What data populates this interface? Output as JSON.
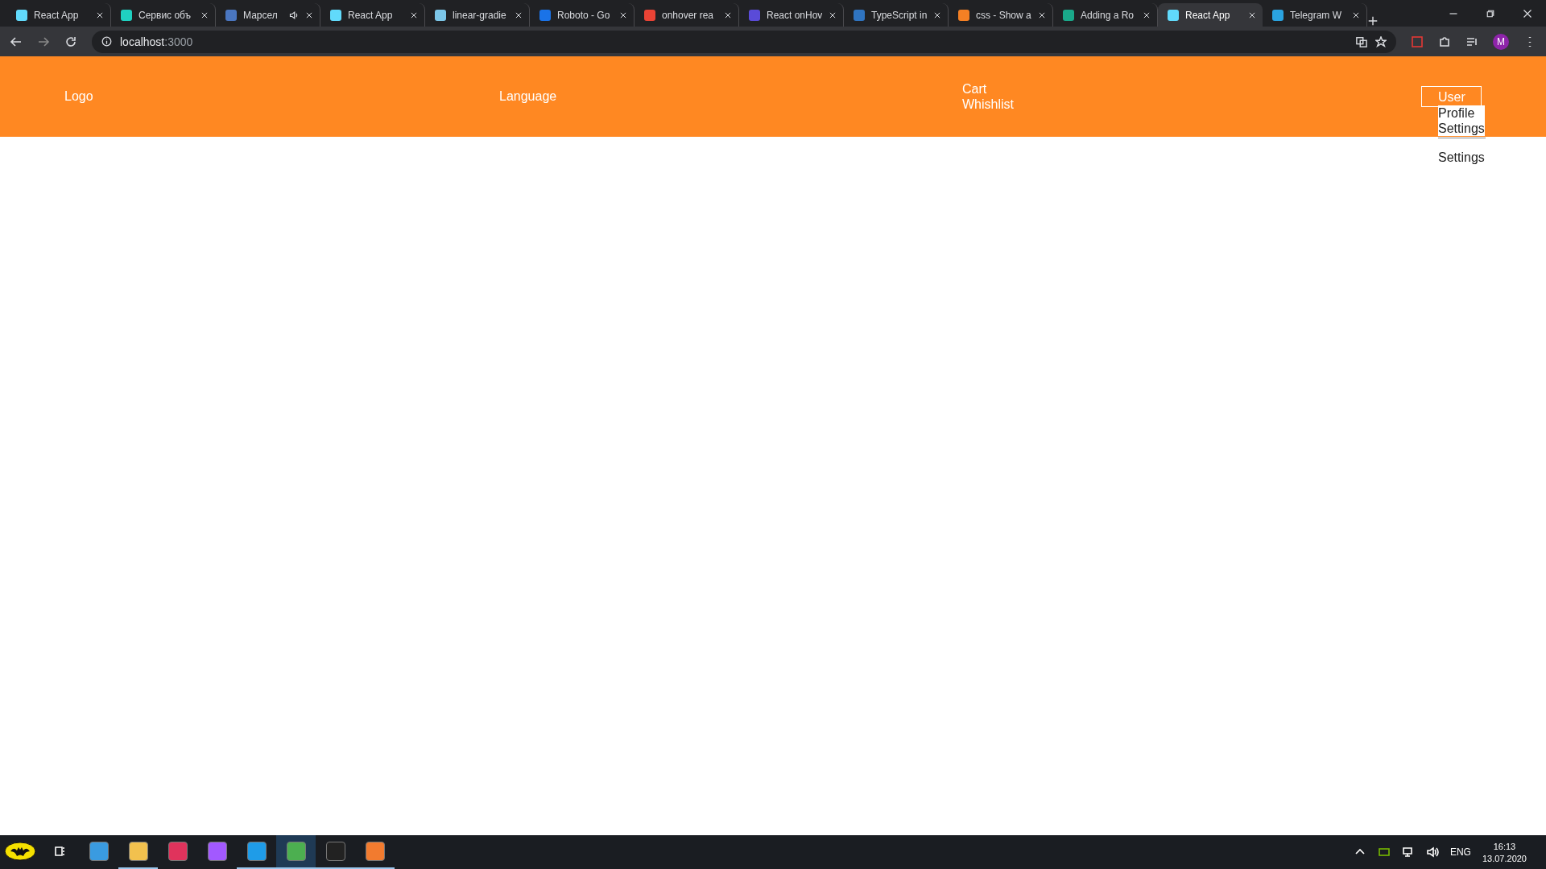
{
  "browser": {
    "tabs": [
      {
        "title": "React App",
        "color": "#61dafb",
        "audio": false,
        "selected": false
      },
      {
        "title": "Сервис объ",
        "color": "#1fd1c1",
        "audio": false,
        "selected": false
      },
      {
        "title": "Марсел",
        "color": "#4a76c0",
        "audio": true,
        "selected": false
      },
      {
        "title": "React App",
        "color": "#61dafb",
        "audio": false,
        "selected": false
      },
      {
        "title": "linear-gradie",
        "color": "#7cc6e8",
        "audio": false,
        "selected": false
      },
      {
        "title": "Roboto - Go",
        "color": "#1a73e8",
        "audio": false,
        "selected": false
      },
      {
        "title": "onhover rea",
        "color": "#ea4335",
        "audio": false,
        "selected": false
      },
      {
        "title": "React onHov",
        "color": "#5a4bd8",
        "audio": false,
        "selected": false
      },
      {
        "title": "TypeScript in",
        "color": "#2f74c0",
        "audio": false,
        "selected": false
      },
      {
        "title": "css - Show a",
        "color": "#f48024",
        "audio": false,
        "selected": false
      },
      {
        "title": "Adding a Ro",
        "color": "#1aa88a",
        "audio": false,
        "selected": false
      },
      {
        "title": "React App",
        "color": "#61dafb",
        "audio": false,
        "selected": true
      },
      {
        "title": "Telegram W",
        "color": "#2aa3e0",
        "audio": false,
        "selected": false
      }
    ],
    "address": {
      "host": "localhost",
      "port": ":3000"
    },
    "profile_initial": "M"
  },
  "header": {
    "logo": "Logo",
    "language": "Language",
    "links": [
      "Cart",
      "Whishlist"
    ],
    "user": {
      "label": "User",
      "menu": [
        "Profile",
        "Settings"
      ],
      "below": "Settings"
    }
  },
  "taskbar": {
    "apps": [
      {
        "color": "#3a9be0",
        "running": false,
        "selected": false
      },
      {
        "color": "#f2c14e",
        "running": true,
        "selected": false
      },
      {
        "color": "#e0335c",
        "running": false,
        "selected": false
      },
      {
        "color": "#a259ff",
        "running": false,
        "selected": false
      },
      {
        "color": "#1f9ce8",
        "running": true,
        "selected": false
      },
      {
        "color": "#4caf50",
        "running": true,
        "selected": true
      },
      {
        "color": "#222222",
        "running": true,
        "selected": false
      },
      {
        "color": "#f27b2f",
        "running": true,
        "selected": false
      }
    ],
    "language": "ENG",
    "time": "16:13",
    "date": "13.07.2020"
  }
}
